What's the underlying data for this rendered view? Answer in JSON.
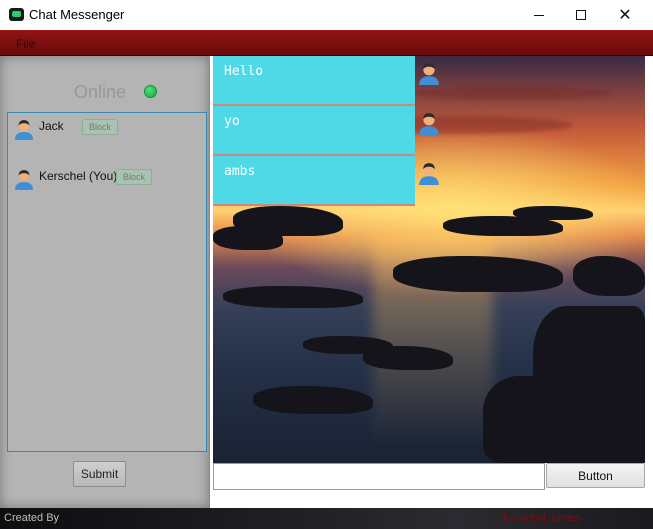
{
  "window": {
    "title": "Chat Messenger",
    "controls": {
      "minimize": "minimize",
      "maximize": "maximize",
      "close": "close"
    }
  },
  "menubar": {
    "file_label": "File"
  },
  "sidebar": {
    "status_label": "Online",
    "status_color": "#22c55e",
    "users": [
      {
        "name": "Jack",
        "block_label": "Block"
      },
      {
        "name": "Kerschel (You)",
        "block_label": "Block"
      }
    ],
    "submit_label": "Submit"
  },
  "chat": {
    "messages": [
      {
        "text": "Hello"
      },
      {
        "text": "yo"
      },
      {
        "text": "ambs"
      }
    ],
    "bubble_color": "#4fd8e6"
  },
  "composer": {
    "input_value": "",
    "send_label": "Button"
  },
  "footer": {
    "created_by_label": "Created By",
    "author": "Kerschel James"
  }
}
